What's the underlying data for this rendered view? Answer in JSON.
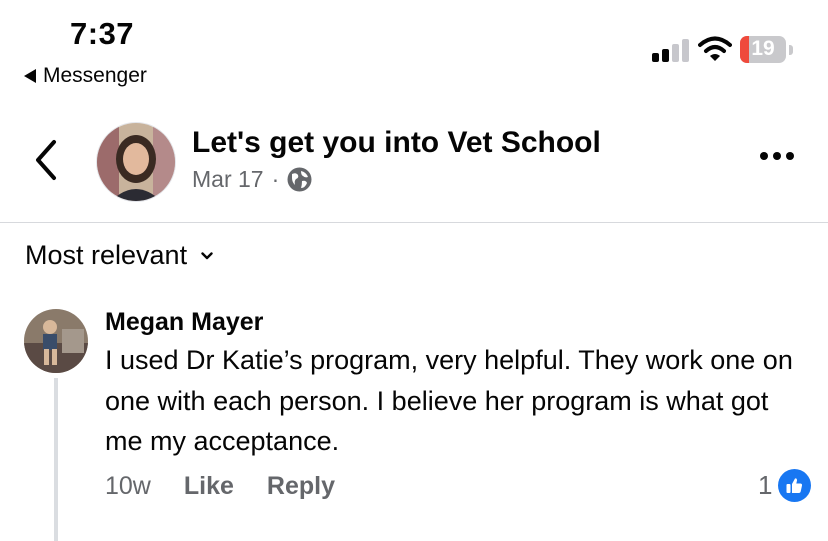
{
  "status_bar": {
    "time": "7:37",
    "back_app": "Messenger",
    "battery_level": "19",
    "battery_fraction": 0.19,
    "battery_color": "#ef4a3c"
  },
  "header": {
    "page_name": "Let's get you into Vet School",
    "date": "Mar 17",
    "separator": "·",
    "audience_icon": "globe-icon"
  },
  "sort": {
    "label": "Most relevant"
  },
  "comment": {
    "author": "Megan Mayer",
    "text": "I used Dr Katie’s program, very helpful. They work one on one with each person. I believe her program is what got me my acceptance.",
    "time_ago": "10w",
    "like_label": "Like",
    "reply_label": "Reply",
    "reaction_count": "1",
    "reaction_icon": "like-thumb-icon"
  },
  "colors": {
    "accent": "#1877f2",
    "secondary_text": "#65676b",
    "divider": "#d7d9dd"
  }
}
